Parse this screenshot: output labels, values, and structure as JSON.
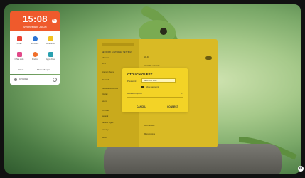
{
  "widget": {
    "time": "15:08",
    "date": "Wednesday, Jul 26",
    "apps": [
      {
        "label": "Gmail",
        "color": "#e94335"
      },
      {
        "label": "Microsoft",
        "color": "#2b74d6"
      },
      {
        "label": "Whiteboard",
        "color": "#f0c21f"
      },
      {
        "label": "Office suite",
        "color": "#e24a8a"
      },
      {
        "label": "Firefox",
        "color": "#f06f2a"
      },
      {
        "label": "Apps drive",
        "color": "#2aa0b0"
      }
    ],
    "dock": {
      "left": "Clear",
      "right": "Show all apps"
    },
    "user": "CTOUCH"
  },
  "settings": {
    "title": "NETWORK & INTERNET SETTINGS",
    "sidebar": [
      "Ethernet",
      "Wi-Fi",
      "Internet sharing",
      "Bluetooth"
    ],
    "section_personal": "PERSONALIZATION",
    "personal_items": [
      "Display",
      "Sound"
    ],
    "section_system": "SYSTEM",
    "system_items": [
      "General",
      "Remote Mgmt",
      "Security",
      "About"
    ],
    "main_rows": [
      "Wi-Fi",
      "Available networks",
      "Add network",
      "More options"
    ]
  },
  "dialog": {
    "title": "CTOUCH-GUEST",
    "password_label": "Password",
    "password_value": "Saturnbo1 1823",
    "show_password": "Show password",
    "advanced": "Advanced options",
    "cancel": "CANCEL",
    "connect": "CONNECT"
  },
  "colors": {
    "accent": "#f3d326",
    "panel": "#d9ba25",
    "clock": "#ef5a2c"
  }
}
